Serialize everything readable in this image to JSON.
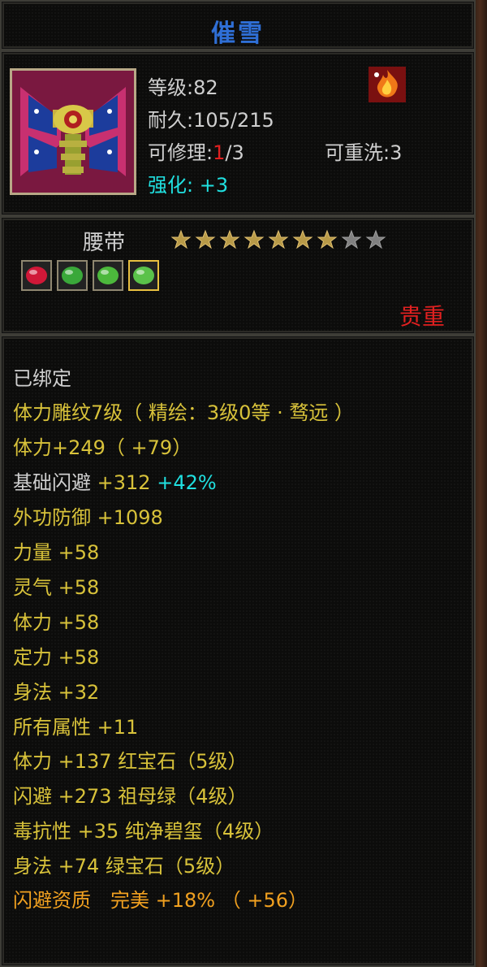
{
  "item": {
    "name": "催雪",
    "level_label": "等级:",
    "level": "82",
    "durability_label": "耐久:",
    "durability": "105/215",
    "repair_label": "可修理:",
    "repair_current": "1",
    "repair_max": "/3",
    "rewash_label": "可重洗:",
    "rewash": "3",
    "enhance_label": "强化:",
    "enhance": "+3",
    "type": "腰带",
    "stars_total": 9,
    "stars_filled": 7,
    "quality": "贵重"
  },
  "gems": [
    {
      "icon": "red-gem-icon",
      "color": "#d01838"
    },
    {
      "icon": "green-gem-icon",
      "color": "#3aa83a"
    },
    {
      "icon": "green-gem-icon",
      "color": "#4cb83c"
    },
    {
      "icon": "green-gem-icon",
      "color": "#5ac24a"
    }
  ],
  "stats": {
    "bound": "已绑定",
    "engrave": "体力雕纹7级（ 精绘：3级0等 · 骛远 ）",
    "stamina_main": "体力+249（ +79）",
    "dodge_label": "基础闪避",
    "dodge_value": "+312",
    "dodge_pct": "+42%",
    "defense": "外功防御 +1098",
    "lines": [
      "力量 +58",
      "灵气 +58",
      "体力 +58",
      "定力 +58",
      "身法 +32",
      "所有属性 +11"
    ],
    "gem_lines": [
      {
        "attr": "体力 +137",
        "gem": "红宝石（5级）"
      },
      {
        "attr": "闪避 +273",
        "gem": "祖母绿（4级）"
      },
      {
        "attr": "毒抗性 +35",
        "gem": "纯净碧玺（4级）"
      },
      {
        "attr": "身法 +74",
        "gem": "绿宝石（5级）"
      }
    ],
    "aptitude": "闪避资质　完美 +18% （ +56）"
  },
  "colors": {
    "title": "#2f6fd6",
    "attr": "#d8c23a",
    "red": "#e02020",
    "cyan": "#20e0e0",
    "aptitude": "#f0a020"
  }
}
